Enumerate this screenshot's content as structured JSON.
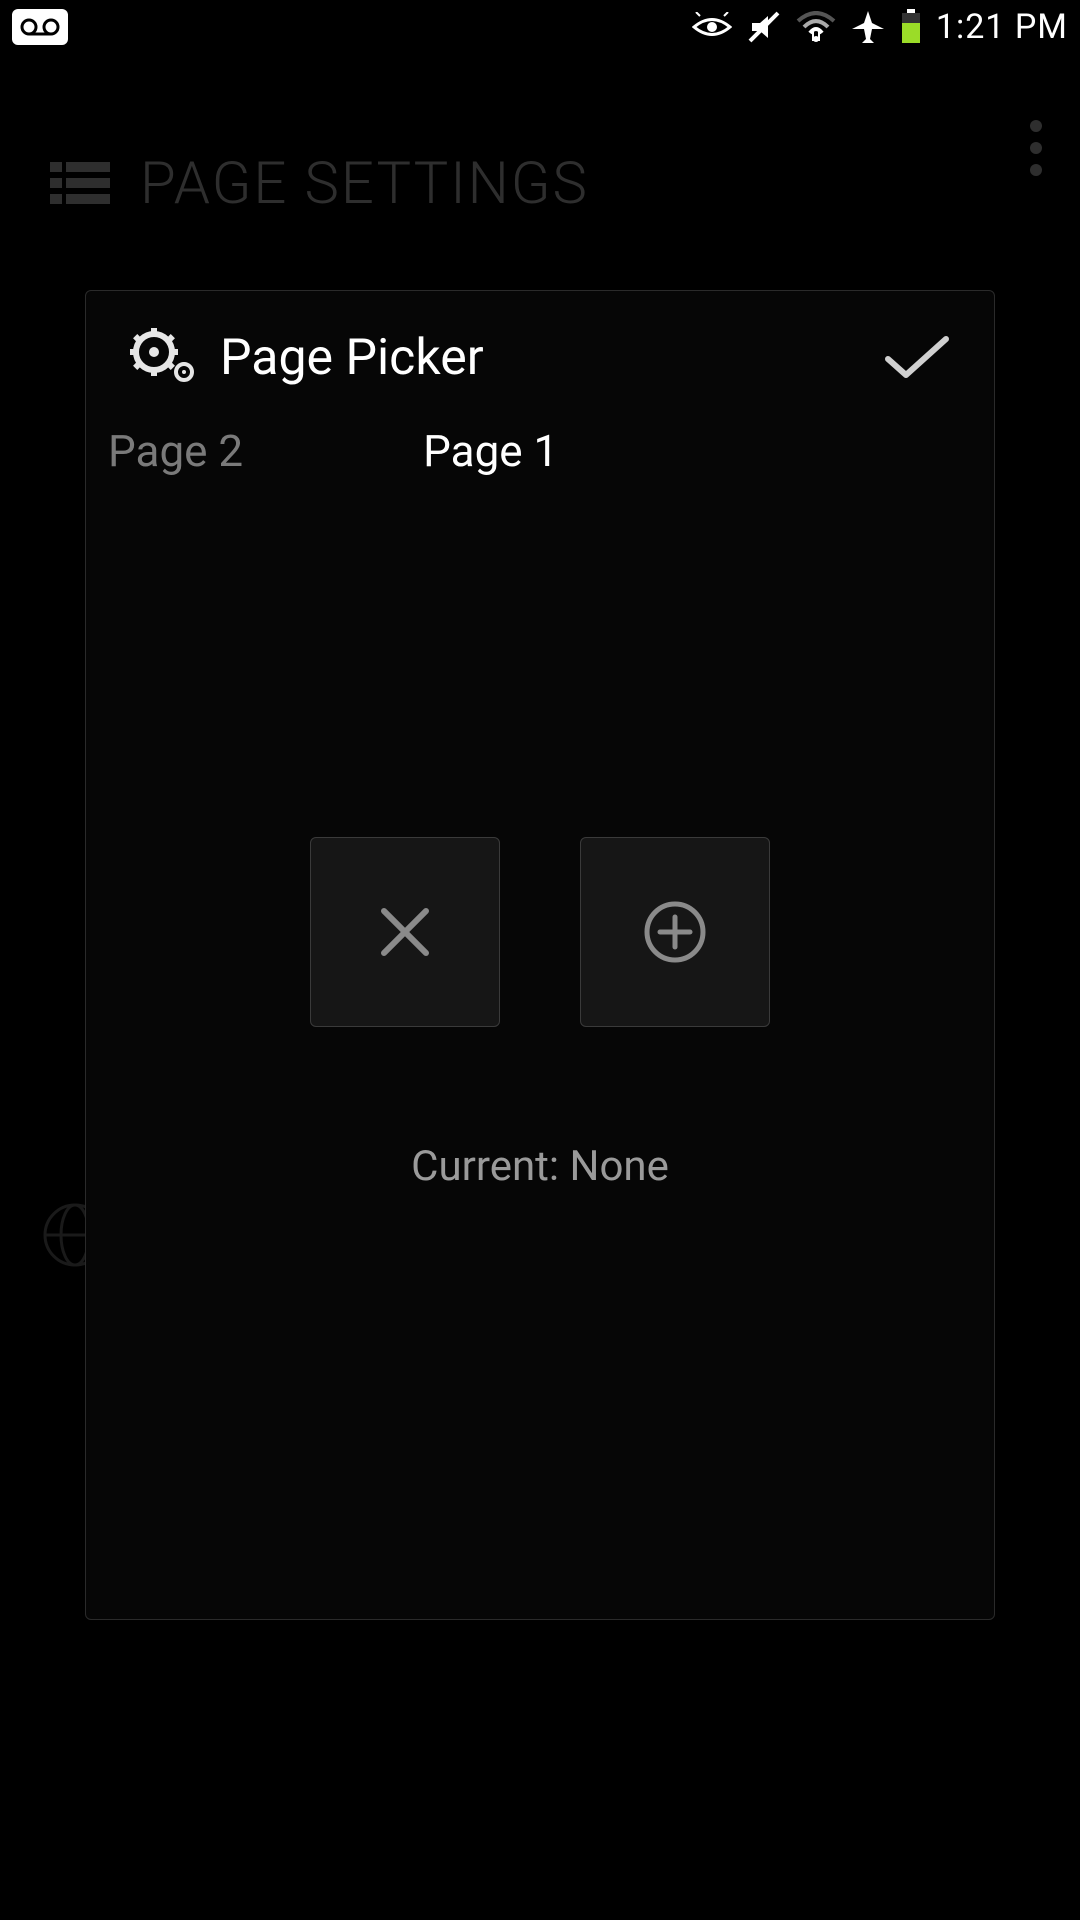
{
  "statusbar": {
    "time": "1:21 PM"
  },
  "background": {
    "header_title": "PAGE SETTINGS"
  },
  "dialog": {
    "title": "Page Picker",
    "tabs": {
      "inactive": "Page 2",
      "active": "Page 1"
    },
    "current_label": "Current: None"
  }
}
